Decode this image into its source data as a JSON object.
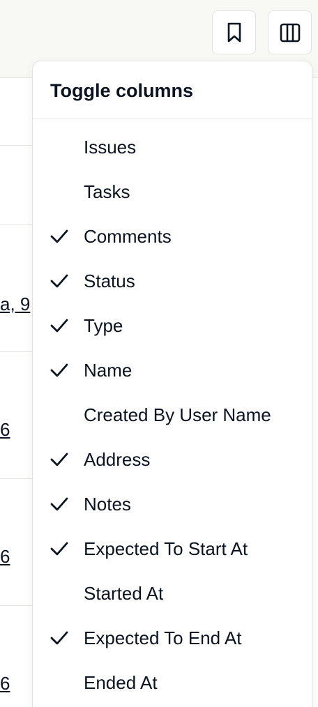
{
  "toolbar": {
    "bookmark_icon": "bookmark-icon",
    "columns_icon": "columns-icon"
  },
  "background": {
    "cell_fragments": [
      "a, 9",
      "6",
      "6",
      "6"
    ]
  },
  "menu": {
    "title": "Toggle columns",
    "items": [
      {
        "label": "Issues",
        "checked": false
      },
      {
        "label": "Tasks",
        "checked": false
      },
      {
        "label": "Comments",
        "checked": true
      },
      {
        "label": "Status",
        "checked": true
      },
      {
        "label": "Type",
        "checked": true
      },
      {
        "label": "Name",
        "checked": true
      },
      {
        "label": "Created By User Name",
        "checked": false
      },
      {
        "label": "Address",
        "checked": true
      },
      {
        "label": "Notes",
        "checked": true
      },
      {
        "label": "Expected To Start At",
        "checked": true
      },
      {
        "label": "Started At",
        "checked": false
      },
      {
        "label": "Expected To End At",
        "checked": true
      },
      {
        "label": "Ended At",
        "checked": false
      }
    ]
  }
}
